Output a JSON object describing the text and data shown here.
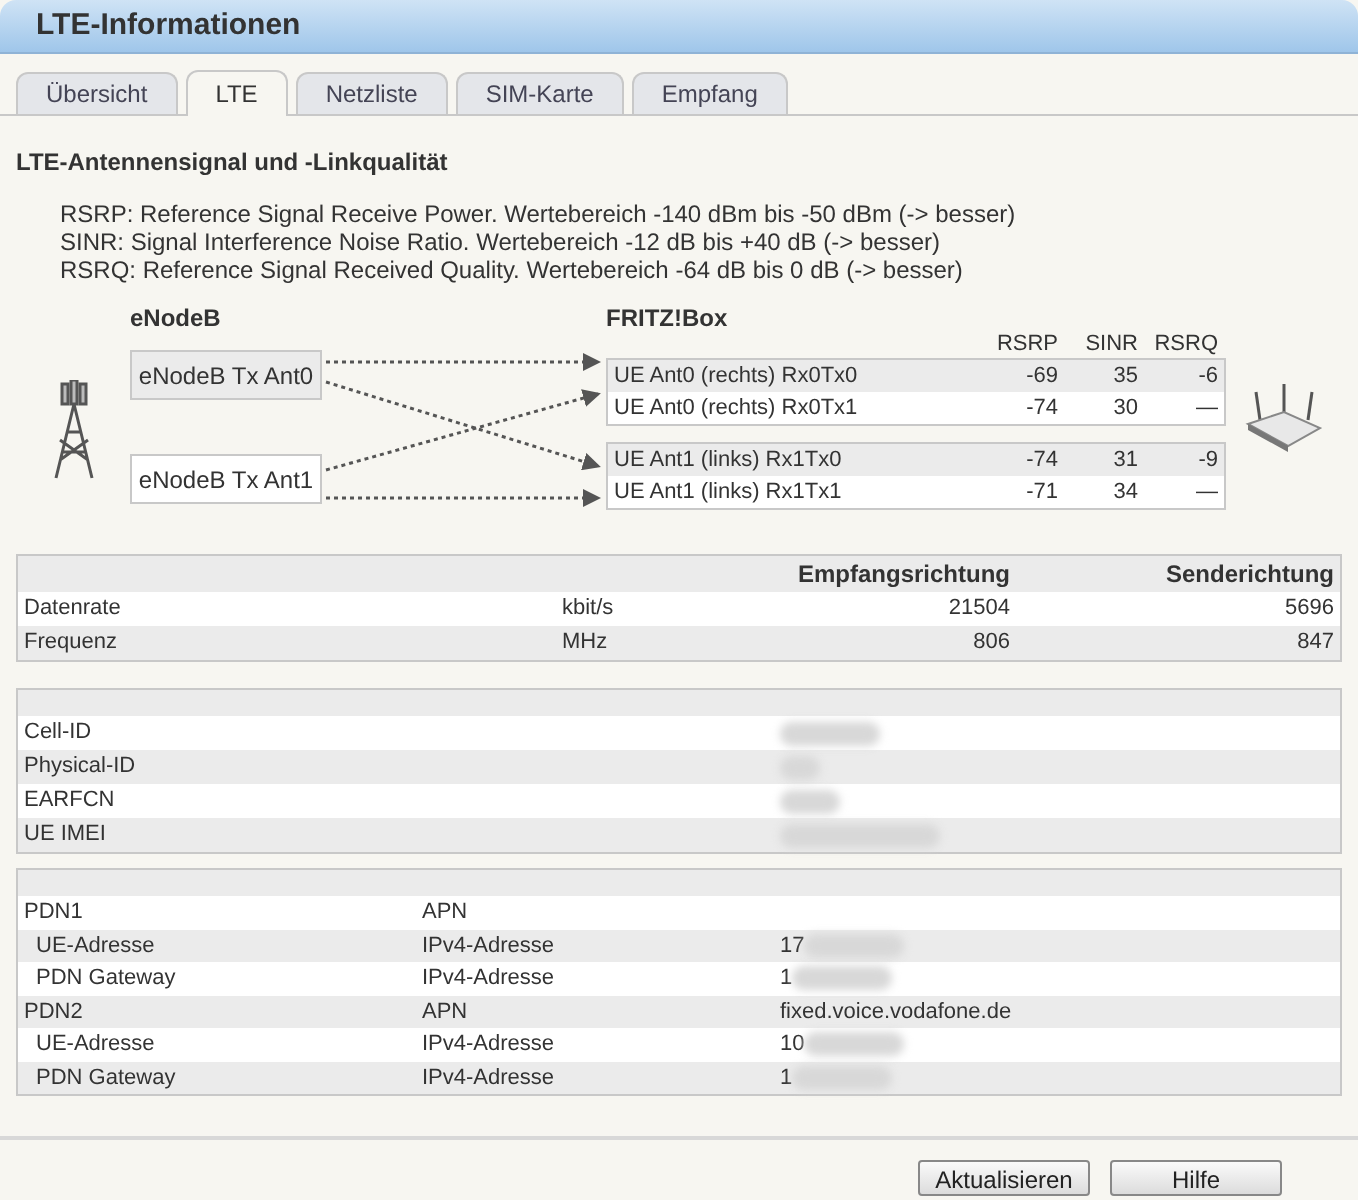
{
  "window": {
    "title": "LTE-Informationen"
  },
  "tabs": [
    {
      "label": "Übersicht",
      "selected": false
    },
    {
      "label": "LTE",
      "selected": true
    },
    {
      "label": "Netzliste",
      "selected": false
    },
    {
      "label": "SIM-Karte",
      "selected": false
    },
    {
      "label": "Empfang",
      "selected": false
    }
  ],
  "heading": "LTE-Antennensignal und -Linkqualität",
  "legend": [
    "RSRP: Reference Signal Receive Power. Wertebereich -140 dBm bis -50 dBm (-> besser)",
    "SINR: Signal Interference Noise Ratio. Wertebereich -12 dB bis +40 dB (-> besser)",
    "RSRQ: Reference Signal Received Quality. Wertebereich -64 dB bis 0 dB (-> besser)"
  ],
  "diagram": {
    "enodeb_title": "eNodeB",
    "fritzbox_title": "FRITZ!Box",
    "columns": [
      "RSRP",
      "SINR",
      "RSRQ"
    ],
    "transmitters": [
      "eNodeB Tx Ant0",
      "eNodeB Tx Ant1"
    ],
    "groups": [
      {
        "rows": [
          {
            "label": "UE Ant0 (rechts) Rx0Tx0",
            "rsrp": "-69",
            "sinr": "35",
            "rsrq": "-6"
          },
          {
            "label": "UE Ant0 (rechts) Rx0Tx1",
            "rsrp": "-74",
            "sinr": "30",
            "rsrq": "—"
          }
        ]
      },
      {
        "rows": [
          {
            "label": "UE Ant1 (links) Rx1Tx0",
            "rsrp": "-74",
            "sinr": "31",
            "rsrq": "-9"
          },
          {
            "label": "UE Ant1 (links) Rx1Tx1",
            "rsrp": "-71",
            "sinr": "34",
            "rsrq": "—"
          }
        ]
      }
    ]
  },
  "rate_table": {
    "columns": [
      "Empfangsrichtung",
      "Senderichtung"
    ],
    "rows": [
      {
        "name": "Datenrate",
        "unit": "kbit/s",
        "rx": "21504",
        "tx": "5696"
      },
      {
        "name": "Frequenz",
        "unit": "MHz",
        "rx": "806",
        "tx": "847"
      }
    ]
  },
  "cell_table": {
    "rows": [
      {
        "name": "Cell-ID"
      },
      {
        "name": "Physical-ID"
      },
      {
        "name": "EARFCN"
      },
      {
        "name": "UE IMEI"
      }
    ]
  },
  "pdn_table": {
    "rows": [
      {
        "kind": "pdn",
        "name": "PDN1",
        "type": "APN"
      },
      {
        "kind": "address",
        "name": "UE-Adresse",
        "type": "IPv4-Adresse",
        "value": "17"
      },
      {
        "kind": "address",
        "name": "PDN Gateway",
        "type": "IPv4-Adresse",
        "value": "1"
      },
      {
        "kind": "pdn",
        "name": "PDN2",
        "type": "APN",
        "value": "fixed.voice.vodafone.de"
      },
      {
        "kind": "address",
        "name": "UE-Adresse",
        "type": "IPv4-Adresse",
        "value": "10"
      },
      {
        "kind": "address",
        "name": "PDN Gateway",
        "type": "IPv4-Adresse",
        "value": "1"
      }
    ]
  },
  "buttons": [
    "Aktualisieren",
    "Hilfe"
  ]
}
